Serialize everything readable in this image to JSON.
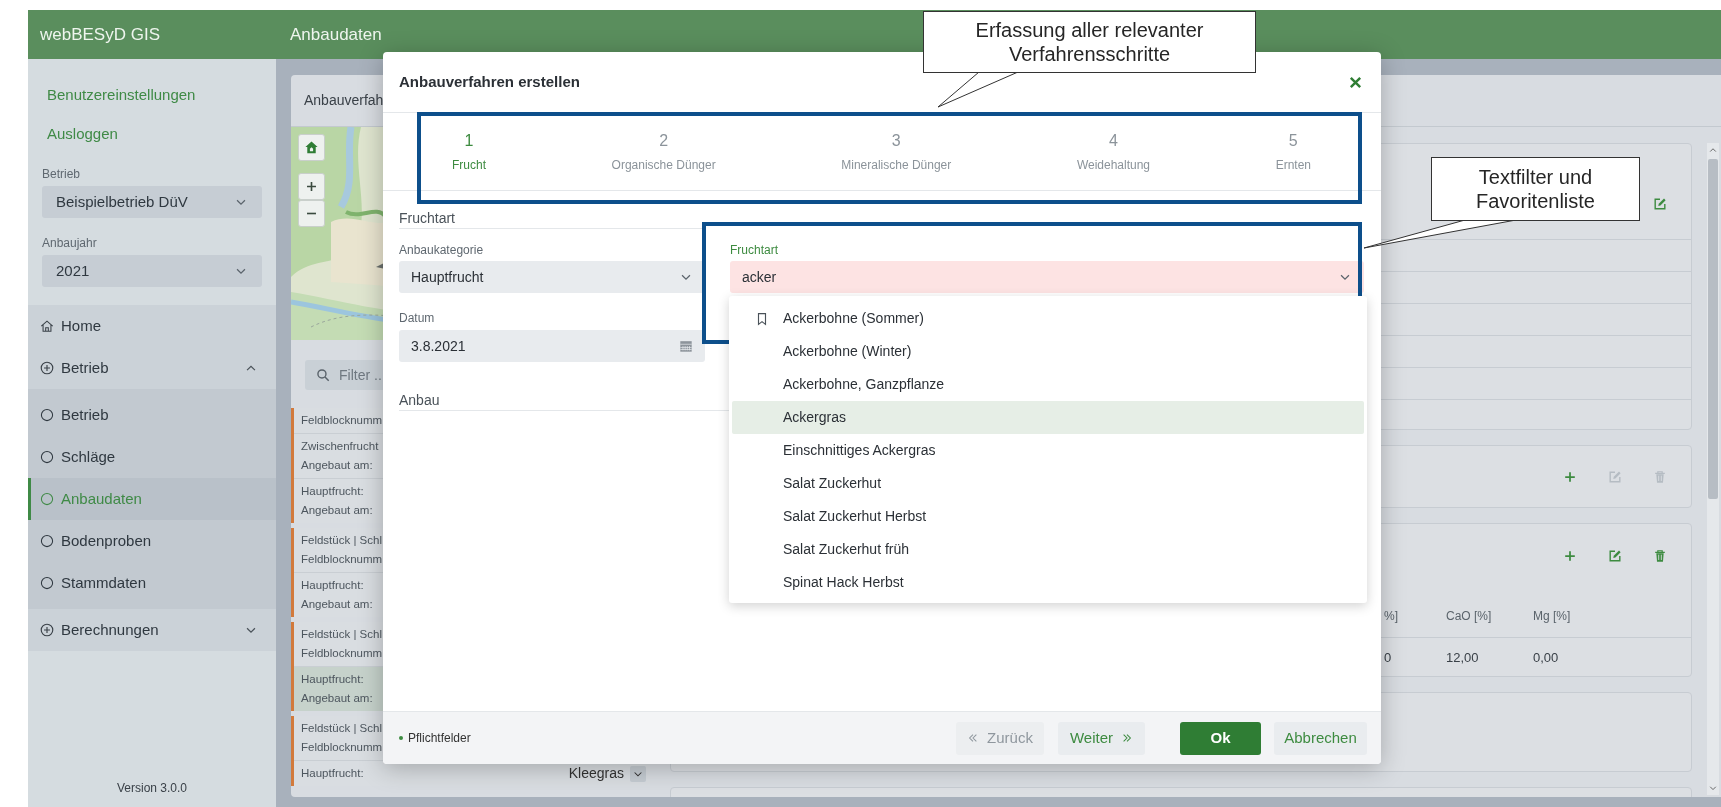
{
  "header": {
    "app_title": "webBESyD GIS",
    "page_title": "Anbaudaten"
  },
  "sidebar": {
    "links": [
      "Benutzereinstellungen",
      "Ausloggen"
    ],
    "selects": [
      {
        "label": "Betrieb",
        "value": "Beispielbetrieb DüV"
      },
      {
        "label": "Anbaujahr",
        "value": "2021"
      }
    ],
    "nav": [
      {
        "kind": "home",
        "label": "Home"
      },
      {
        "kind": "group",
        "label": "Betrieb",
        "expanded": true,
        "children": [
          {
            "label": "Betrieb",
            "selected": false
          },
          {
            "label": "Schläge",
            "selected": false
          },
          {
            "label": "Anbaudaten",
            "selected": true
          },
          {
            "label": "Bodenproben",
            "selected": false
          },
          {
            "label": "Stammdaten",
            "selected": false
          }
        ]
      },
      {
        "kind": "group",
        "label": "Berechnungen",
        "expanded": false
      }
    ],
    "version": "Version 3.0.0"
  },
  "list_panel": {
    "title": "Anbauverfah",
    "filter": {
      "placeholder": "Filter ..."
    },
    "entries": [
      {
        "groups": [
          {
            "lines": [
              "Feldblocknumm"
            ],
            "highlighted": false
          },
          {
            "lines": [
              "Zwischenfrucht",
              "Angebaut am:"
            ],
            "highlighted": false
          },
          {
            "lines": [
              "Hauptfrucht:",
              "Angebaut am:"
            ],
            "highlighted": false
          }
        ]
      },
      {
        "groups": [
          {
            "lines": [
              "Feldstück | Schl",
              "Feldblocknumm"
            ],
            "highlighted": false
          },
          {
            "lines": [
              "Hauptfrucht:",
              "Angebaut am:"
            ],
            "highlighted": false
          }
        ]
      },
      {
        "groups": [
          {
            "lines": [
              "Feldstück | Schl",
              "Feldblocknumm"
            ],
            "highlighted": false
          },
          {
            "lines": [
              "Hauptfrucht:",
              "Angebaut am:"
            ],
            "highlighted": true
          }
        ]
      },
      {
        "groups": [
          {
            "lines": [
              "Feldstück | Schl",
              "Feldblocknumm"
            ],
            "highlighted": false
          },
          {
            "lines": [
              "Hauptfrucht:"
            ],
            "value": "Kleegras",
            "highlighted": false
          }
        ]
      }
    ]
  },
  "detail_panels": [
    {
      "kind": "list",
      "actions": [
        {
          "kind": "edit",
          "disabled": false
        }
      ]
    },
    {
      "kind": "actions",
      "actions": [
        {
          "kind": "add",
          "disabled": false
        },
        {
          "kind": "edit",
          "disabled": true
        },
        {
          "kind": "delete",
          "disabled": true
        }
      ]
    },
    {
      "kind": "table",
      "actions": [
        {
          "kind": "add",
          "disabled": false
        },
        {
          "kind": "edit",
          "disabled": false
        },
        {
          "kind": "delete",
          "disabled": false
        }
      ],
      "table": {
        "columns": [
          "%]",
          "CaO [%]",
          "Mg [%]"
        ],
        "rows": [
          [
            "0",
            "12,00",
            "0,00"
          ]
        ]
      }
    },
    {
      "kind": "empty"
    },
    {
      "kind": "empty"
    }
  ],
  "dialog": {
    "title": "Anbauverfahren erstellen",
    "steps": [
      {
        "number": "1",
        "label": "Frucht",
        "selected": true
      },
      {
        "number": "2",
        "label": "Organische Dünger",
        "selected": false
      },
      {
        "number": "3",
        "label": "Mineralische Dünger",
        "selected": false
      },
      {
        "number": "4",
        "label": "Weidehaltung",
        "selected": false
      },
      {
        "number": "5",
        "label": "Ernten",
        "selected": false
      }
    ],
    "section_title": "Fruchtart",
    "fields": [
      {
        "kind": "select",
        "label": "Anbaukategorie",
        "value": "Hauptfrucht"
      },
      {
        "kind": "date",
        "label": "Datum",
        "value": "3.8.2021"
      }
    ],
    "crop_field": {
      "label": "Fruchtart",
      "value": "acker",
      "focused": true,
      "invalid": true,
      "options": [
        {
          "label": "Ackerbohne (Sommer)",
          "favorite": true,
          "selected": false
        },
        {
          "label": "Ackerbohne (Winter)",
          "favorite": false,
          "selected": false
        },
        {
          "label": "Ackerbohne, Ganzpflanze",
          "favorite": false,
          "selected": false
        },
        {
          "label": "Ackergras",
          "favorite": false,
          "selected": true
        },
        {
          "label": "Einschnittiges Ackergras",
          "favorite": false,
          "selected": false
        },
        {
          "label": "Salat Zuckerhut",
          "favorite": false,
          "selected": false
        },
        {
          "label": "Salat Zuckerhut Herbst",
          "favorite": false,
          "selected": false
        },
        {
          "label": "Salat Zuckerhut früh",
          "favorite": false,
          "selected": false
        },
        {
          "label": "Spinat Hack Herbst",
          "favorite": false,
          "selected": false
        }
      ]
    },
    "second_section_title": "Anbau",
    "footer_note": "Pflichtfelder",
    "buttons": [
      {
        "kind": "back",
        "label": "Zurück",
        "disabled": true
      },
      {
        "kind": "next",
        "label": "Weiter",
        "disabled": false
      },
      {
        "kind": "ok",
        "label": "Ok",
        "disabled": false
      },
      {
        "kind": "cancel",
        "label": "Abbrechen",
        "disabled": false
      }
    ]
  },
  "annotations": [
    {
      "lines": [
        "Erfassung aller relevanter",
        "Verfahrensschritte"
      ]
    },
    {
      "lines": [
        "Textfilter und",
        "Favoritenliste"
      ]
    }
  ]
}
